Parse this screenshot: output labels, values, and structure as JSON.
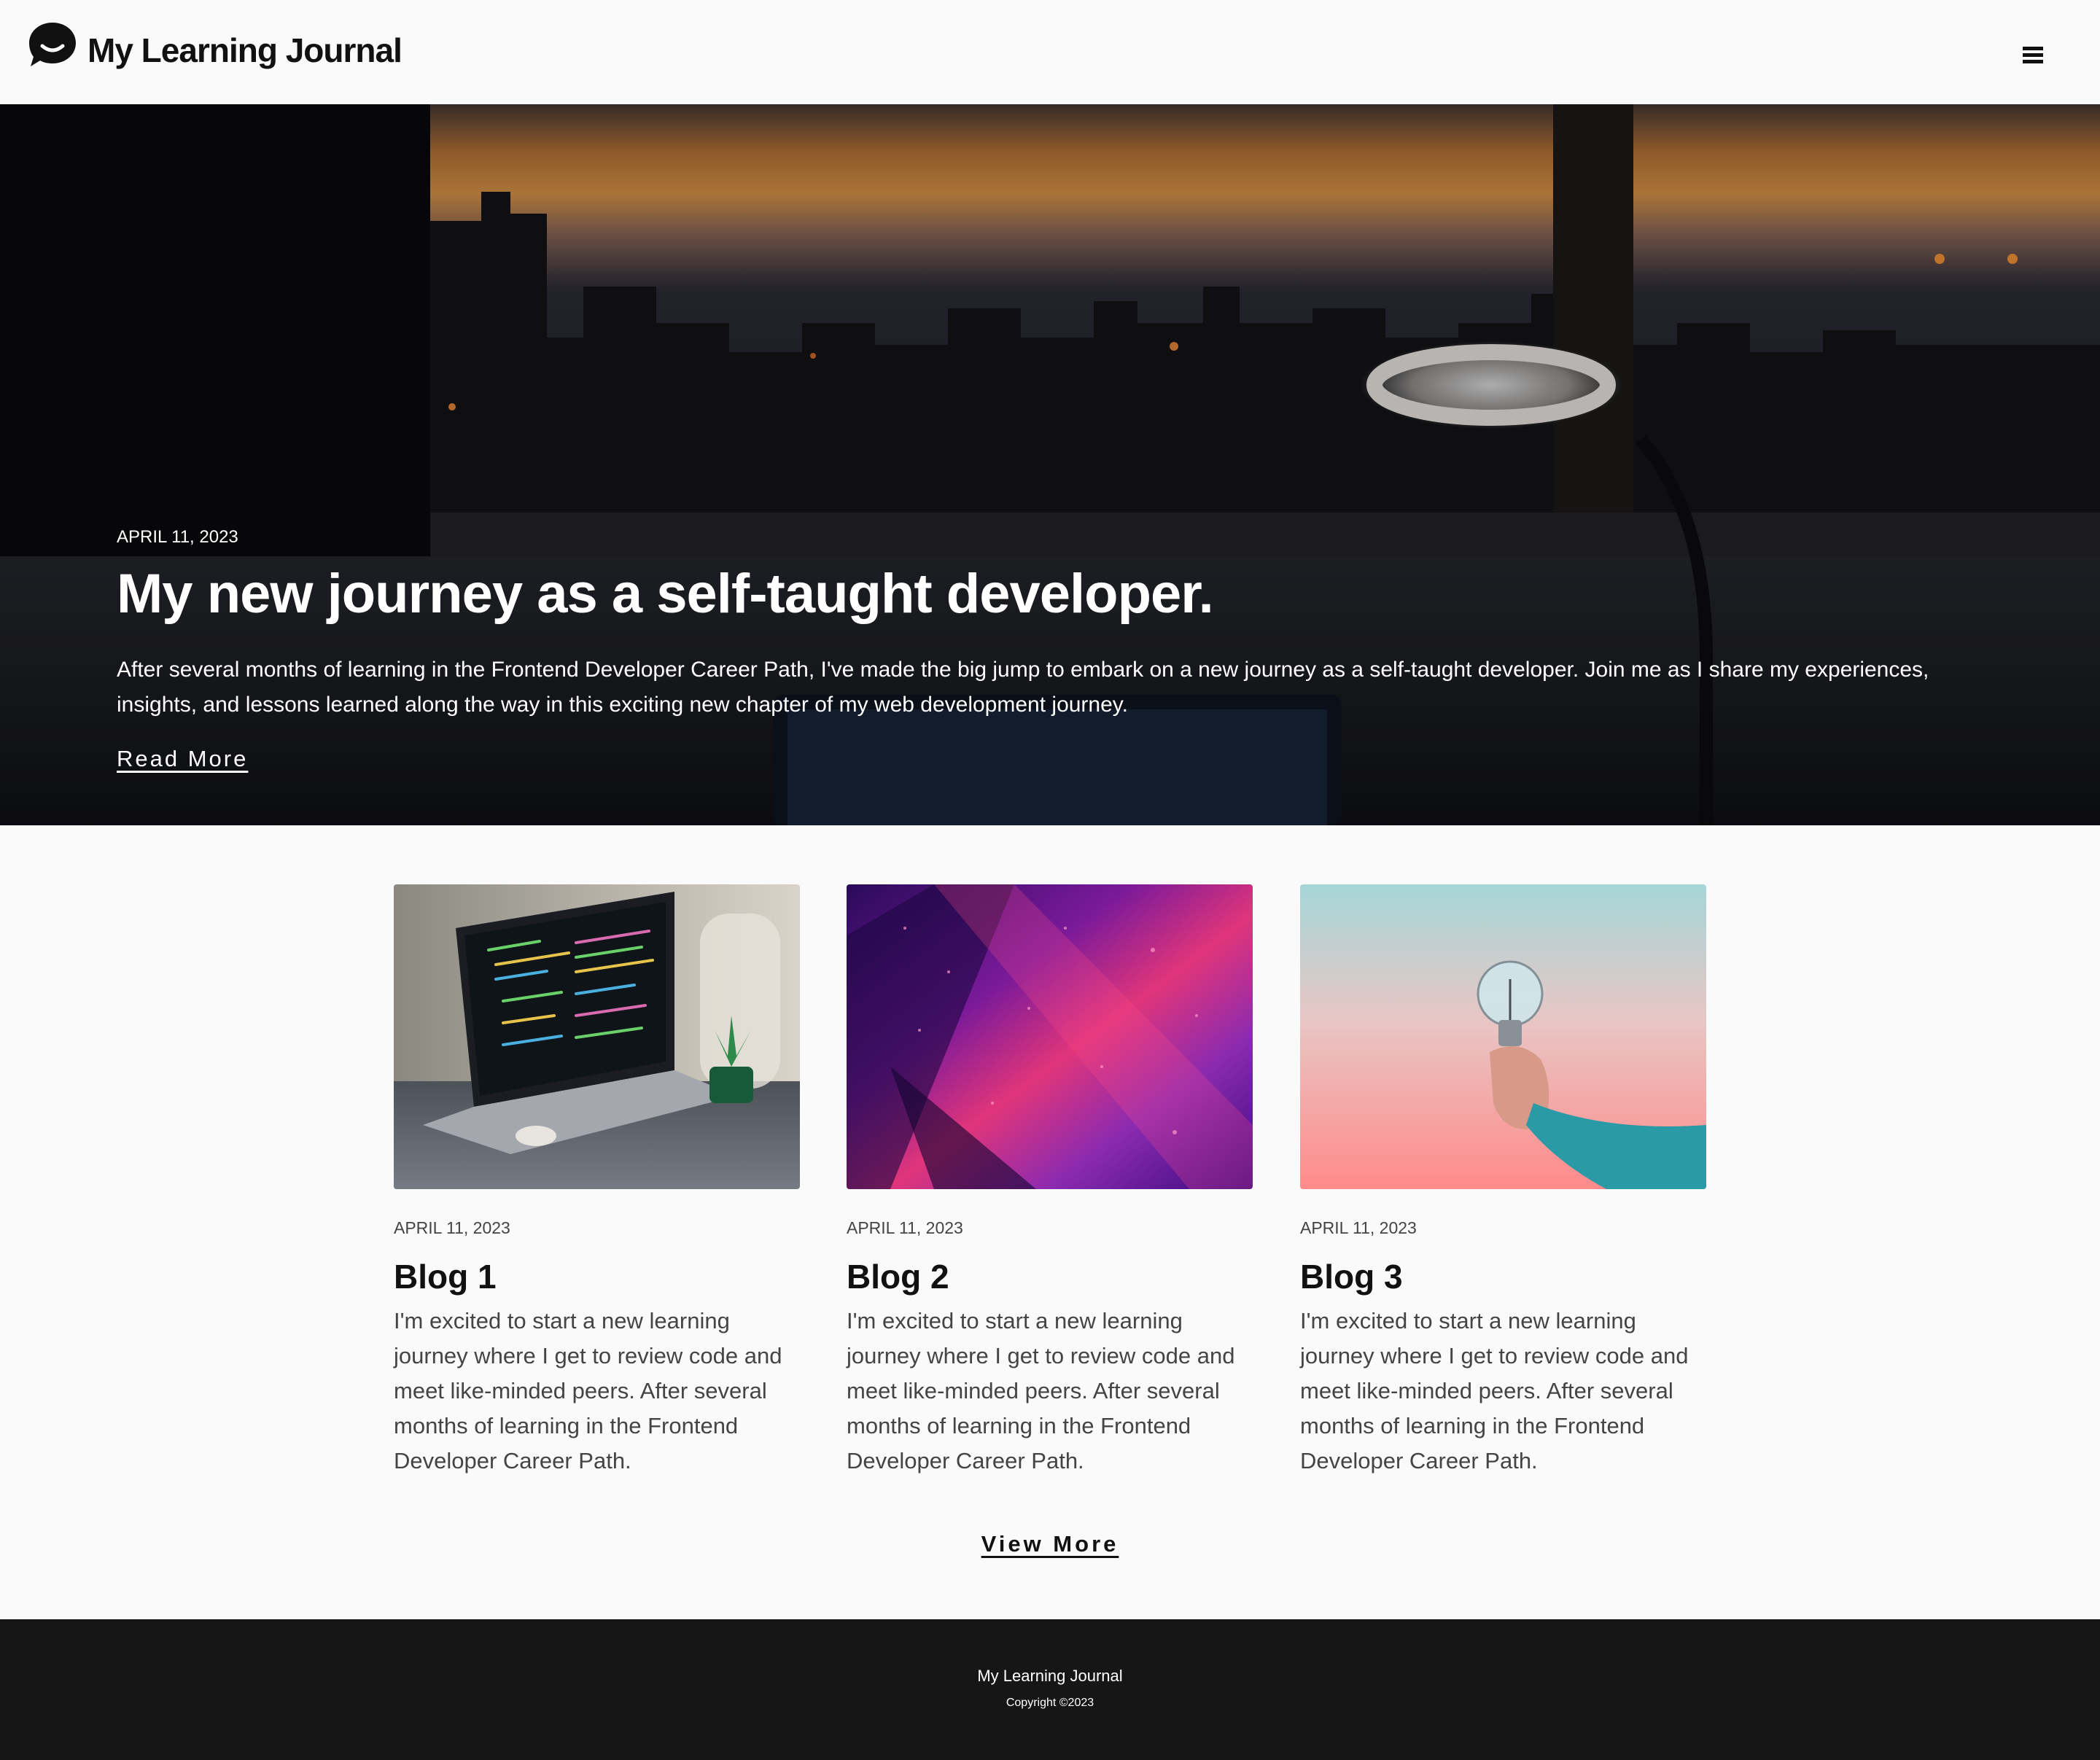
{
  "header": {
    "logo_icon": "chat-bubble-smile-icon",
    "title": "My Learning Journal",
    "menu_icon": "hamburger-menu-icon"
  },
  "hero": {
    "date": "APRIL 11, 2023",
    "title": "My new journey as a self-taught developer.",
    "text": "After several months of learning in the Frontend Developer Career Path, I've made the big jump to embark on a new journey as a self-taught developer. Join me as I share my experiences, insights, and lessons learned along the way in this exciting new chapter of my web development journey.",
    "link_label": "Read More",
    "image": "sunset-city-window-desk-lamp-laptop"
  },
  "posts": [
    {
      "date": "APRIL 11, 2023",
      "title": "Blog 1",
      "text": "I'm excited to start a new learning journey where I get to review code and meet like-minded peers. After several months of learning in the Frontend Developer Career Path.",
      "image": "laptop-with-code-and-plant"
    },
    {
      "date": "APRIL 11, 2023",
      "title": "Blog 2",
      "text": "I'm excited to start a new learning journey where I get to review code and meet like-minded peers. After several months of learning in the Frontend Developer Career Path.",
      "image": "purple-neon-abstract"
    },
    {
      "date": "APRIL 11, 2023",
      "title": "Blog 3",
      "text": "I'm excited to start a new learning journey where I get to review code and meet like-minded peers. After several months of learning in the Frontend Developer Career Path.",
      "image": "hand-holding-light-bulb"
    }
  ],
  "view_more_label": "View More",
  "footer": {
    "title": "My Learning Journal",
    "copyright": "Copyright ©2023"
  },
  "colors": {
    "page_background": "#fafafa",
    "text": "#111111",
    "muted_text": "#444444",
    "footer_background": "#161616",
    "hero_text": "#ffffff"
  }
}
